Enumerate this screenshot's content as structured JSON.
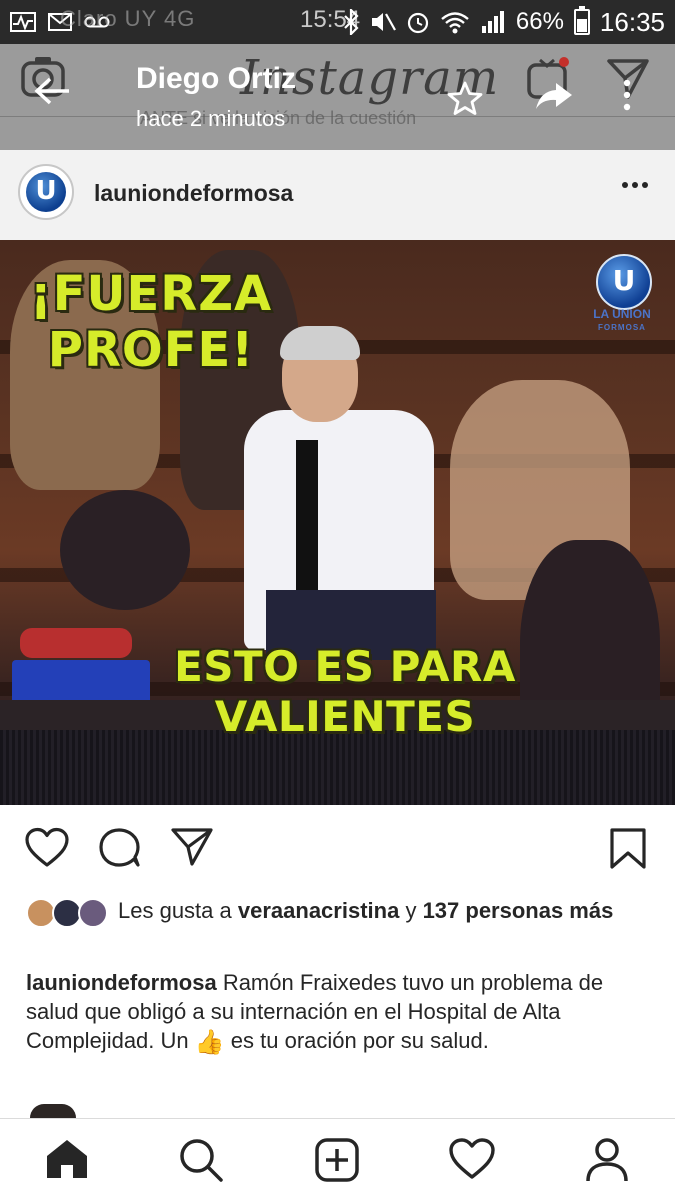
{
  "status_bar": {
    "left_ghost": "Claro UY  4G",
    "center_ghost": "15:54",
    "battery": "66%",
    "time": "16:35"
  },
  "header": {
    "logo": "Instagram",
    "underlying_text": "ANTE si ve la visión de la cuestión"
  },
  "overlay": {
    "name": "Diego Ortiz",
    "subtitle": "hace 2 minutos"
  },
  "post": {
    "username": "launiondeformosa",
    "avatar_letter": "U",
    "image": {
      "headline": "¡FUERZA PROFE!",
      "footer": "ESTO ES PARA VALIENTES",
      "watermark_letter": "U",
      "watermark_text": "LA UNION",
      "watermark_sub": "FORMOSA"
    },
    "likes": {
      "prefix": "Les gusta a",
      "user": "veraanacristina",
      "connector": "y",
      "count_text": "137 personas más"
    },
    "caption": {
      "user": "launiondeformosa",
      "text_before": "Ramón Fraixedes tuvo un problema de salud que obligó a su internación en el Hospital de Alta Complejidad. Un",
      "emoji": "👍",
      "text_after": "es tu oración por su salud."
    }
  },
  "colors": {
    "meme_text": "#d6ec2a",
    "header_dim": "#9b9b9b",
    "accent_blue": "#0f3f93"
  },
  "icons": [
    "camera-icon",
    "igtv-icon",
    "direct-icon",
    "back-arrow-icon",
    "star-icon",
    "share-icon",
    "more-vertical-icon",
    "more-horizontal-icon",
    "heart-icon",
    "comment-icon",
    "send-icon",
    "bookmark-icon",
    "home-icon",
    "search-icon",
    "add-icon",
    "activity-heart-icon",
    "profile-icon"
  ]
}
